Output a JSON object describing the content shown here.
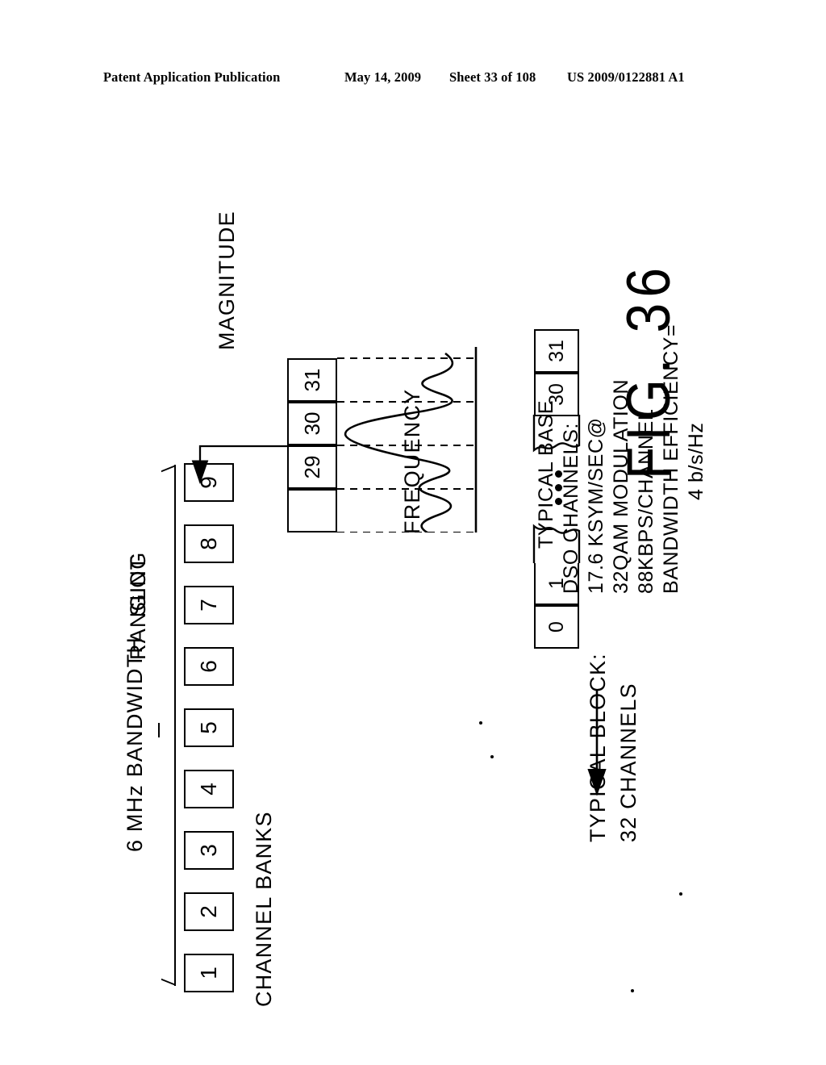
{
  "header": {
    "publication": "Patent Application Publication",
    "date": "May 14, 2009",
    "sheet": "Sheet 33 of 108",
    "patent_number": "US 2009/0122881 A1"
  },
  "figure": {
    "caption": "FIG. 36",
    "bandwidth_label": "6 MHz BANDWIDTH",
    "channel_banks_label": "CHANNEL BANKS",
    "ranging_slot_label_line1": "RANGING",
    "ranging_slot_label_line2": "SLOT",
    "typical_block_line1": "TYPICAL BLOCK:",
    "typical_block_line2": "32 CHANNELS",
    "magnitude_axis_label": "MAGNITUDE",
    "frequency_axis_label": "FREQUENCY",
    "channel_banks": [
      "1",
      "2",
      "3",
      "4",
      "5",
      "6",
      "7",
      "8",
      "9"
    ],
    "block_channels_low": [
      "0",
      "1"
    ],
    "block_channels_high": [
      "30",
      "31"
    ],
    "spectrum_channels": [
      "29",
      "30",
      "31"
    ],
    "spec_lines": [
      "TYPICAL BASE",
      "DSO CHANNELS:",
      "17.6 KSYM/SEC@",
      "32QAM MODULATION",
      "88KBPS/CHANNEL",
      "BANDWIDTH EFFICIENCY=",
      "4 b/s/Hz"
    ]
  },
  "chart_data": {
    "type": "line",
    "title": "",
    "xlabel": "FREQUENCY",
    "ylabel": "MAGNITUDE",
    "grid": true,
    "legend": "none",
    "description": "Undulating channel spectrum magnitude versus frequency aligned to channel slots 29, 30 and 31",
    "gridline_channels": [
      "29",
      "30",
      "31"
    ],
    "x": [
      0,
      0.06,
      0.12,
      0.18,
      0.24,
      0.3,
      0.36,
      0.42,
      0.48,
      0.54,
      0.6,
      0.66,
      0.72,
      0.78,
      0.84,
      0.9,
      0.96,
      1.0
    ],
    "values": [
      0.22,
      0.46,
      0.3,
      0.18,
      0.44,
      0.58,
      0.34,
      0.2,
      0.52,
      0.88,
      1.0,
      0.8,
      0.4,
      0.22,
      0.5,
      0.66,
      0.42,
      0.26
    ],
    "xlim": [
      0,
      1
    ],
    "ylim": [
      0,
      1
    ]
  }
}
